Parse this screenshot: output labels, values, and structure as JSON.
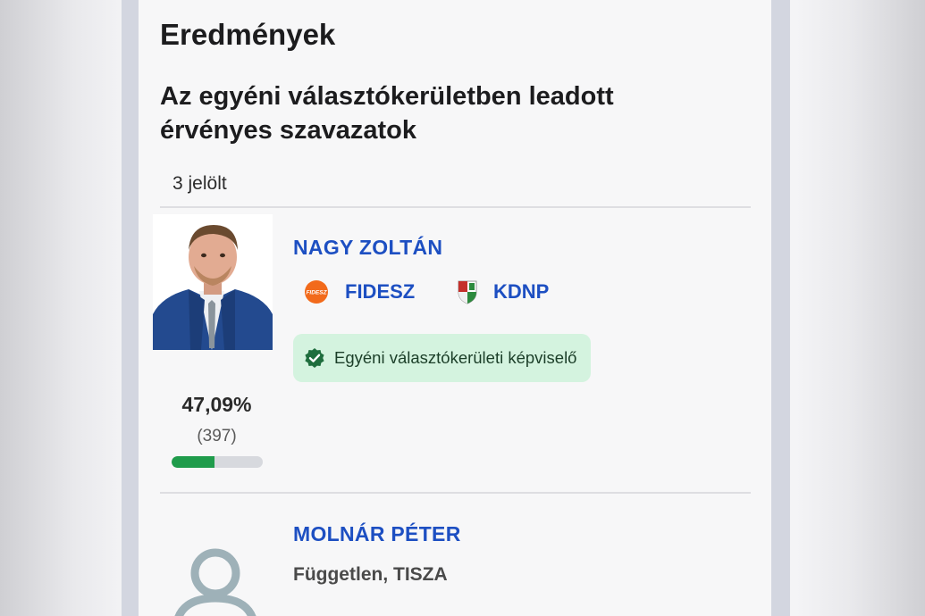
{
  "page": {
    "title": "Eredmények",
    "subtitle": "Az egyéni választókerületben leadott érvényes szavazatok",
    "candidate_count": "3 jelölt"
  },
  "candidates": [
    {
      "name": "NAGY ZOLTÁN",
      "parties": [
        {
          "label": "FIDESZ",
          "icon": "fidesz-logo-icon",
          "logo_text": "FIDESZ"
        },
        {
          "label": "KDNP",
          "icon": "kdnp-shield-icon"
        }
      ],
      "badge": "Egyéni választókerületi képviselő",
      "percent": "47,09%",
      "votes": "(397)",
      "vote_fraction": 0.4709
    },
    {
      "name": "MOLNÁR PÉTER",
      "affiliation": "Független, TISZA",
      "avatar_icon": "user-placeholder-icon"
    }
  ],
  "colors": {
    "name_blue": "#1d4fc2",
    "badge_bg": "#d4f3df",
    "badge_check": "#1f6e3e",
    "bar_fill": "#1f9c4b",
    "bar_track": "#d7d9de",
    "fidesz_orange": "#f26a1b"
  }
}
